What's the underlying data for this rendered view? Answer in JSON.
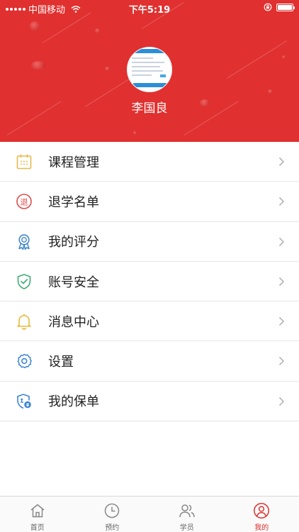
{
  "status_bar": {
    "carrier": "中国移动",
    "time": "下午5:19"
  },
  "profile": {
    "name": "李国良"
  },
  "menu": {
    "items": [
      {
        "label": "课程管理",
        "icon": "calendar-icon"
      },
      {
        "label": "退学名单",
        "icon": "withdraw-icon"
      },
      {
        "label": "我的评分",
        "icon": "award-ribbon-icon"
      },
      {
        "label": "账号安全",
        "icon": "shield-check-icon"
      },
      {
        "label": "消息中心",
        "icon": "bell-icon"
      },
      {
        "label": "设置",
        "icon": "gear-icon"
      },
      {
        "label": "我的保单",
        "icon": "insurance-icon"
      }
    ],
    "withdraw_glyph": "退"
  },
  "tabbar": {
    "tabs": [
      {
        "label": "首页",
        "icon": "home-icon",
        "active": false
      },
      {
        "label": "预约",
        "icon": "clock-icon",
        "active": false
      },
      {
        "label": "学员",
        "icon": "users-icon",
        "active": false
      },
      {
        "label": "我的",
        "icon": "person-circle-icon",
        "active": true
      }
    ]
  },
  "colors": {
    "brand_red": "#e0302f",
    "calendar": "#e6b94a",
    "withdraw": "#e14b4b",
    "award": "#3f86d1",
    "shield": "#3fae74",
    "bell": "#e9b83a",
    "gear": "#3f86d1",
    "insurance": "#3f86d1"
  }
}
